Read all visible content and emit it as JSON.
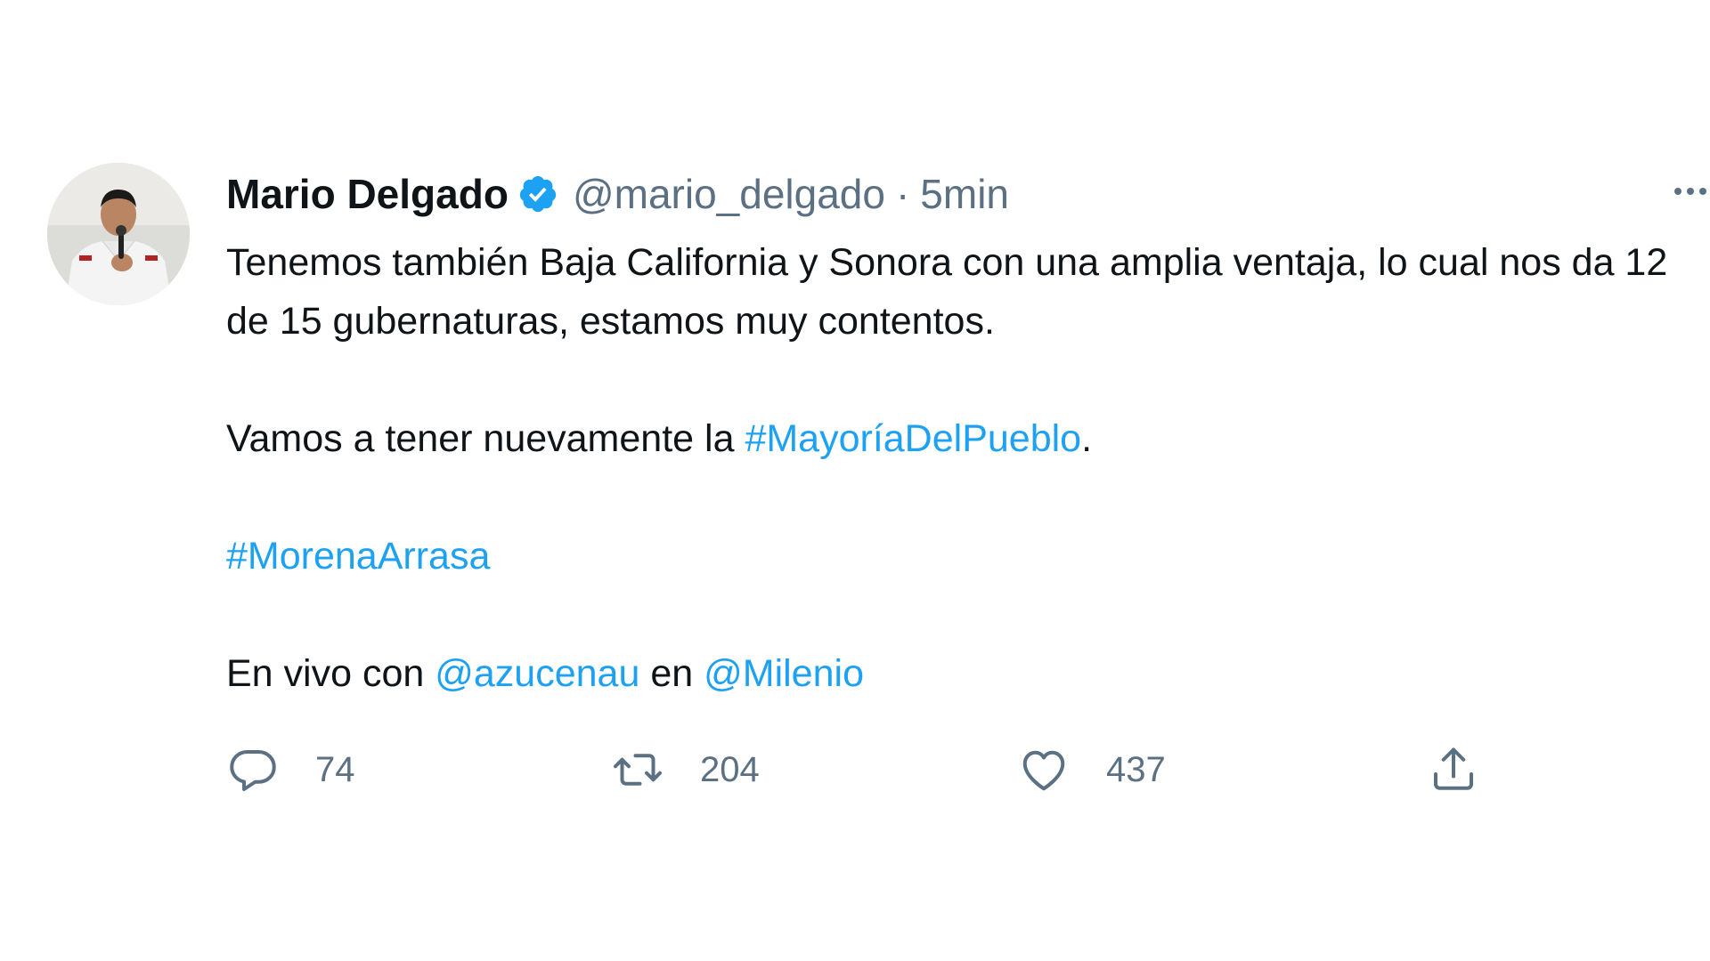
{
  "tweet": {
    "author": {
      "name": "Mario Delgado",
      "verified_icon": "verified-badge-icon",
      "handle": "@mario_delgado",
      "separator": "·",
      "time": "5min"
    },
    "more_icon": "more-options-icon",
    "text": {
      "line1": "Tenemos también Baja California y Sonora con una amplia ventaja, lo cual nos da 12 de 15 gubernaturas, estamos muy contentos.",
      "line2_prefix": "Vamos a tener nuevamente la ",
      "line2_hashtag": "#MayoríaDelPueblo",
      "line2_suffix": ".",
      "hashtag2": "#MorenaArrasa",
      "line4_prefix": "En vivo con ",
      "mention1": "@azucenau",
      "line4_mid": " en ",
      "mention2": "@Milenio"
    },
    "actions": {
      "reply": {
        "icon": "reply-icon",
        "count": "74"
      },
      "retweet": {
        "icon": "retweet-icon",
        "count": "204"
      },
      "like": {
        "icon": "heart-icon",
        "count": "437"
      },
      "share": {
        "icon": "share-icon"
      }
    },
    "colors": {
      "link": "#1da1f2",
      "secondary_text": "#5b7083",
      "verified": "#1da1f2"
    }
  }
}
